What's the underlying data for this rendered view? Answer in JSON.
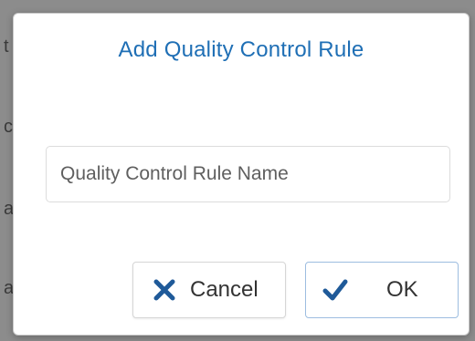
{
  "dialog": {
    "title": "Add Quality Control Rule",
    "name_input": {
      "value": "",
      "placeholder": "Quality Control Rule Name"
    },
    "buttons": {
      "cancel_label": "Cancel",
      "ok_label": "OK"
    }
  },
  "background": {
    "partial_letters": [
      "t",
      "c",
      "a",
      "a"
    ]
  },
  "icons": {
    "cancel": "close-icon",
    "ok": "checkmark-icon"
  },
  "colors": {
    "title": "#1f6fb5",
    "icon": "#1f5a99",
    "ok_border": "#9dbde0",
    "backdrop": "#8c8c8c"
  }
}
